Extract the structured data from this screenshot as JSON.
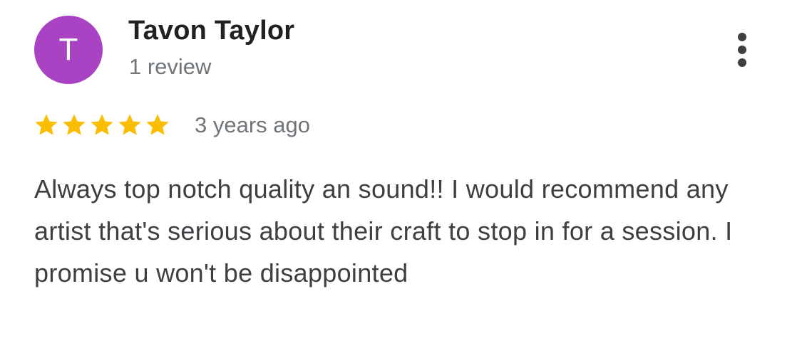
{
  "review": {
    "avatar_letter": "T",
    "avatar_color": "#a943c4",
    "author_name": "Tavon Taylor",
    "review_count": "1 review",
    "rating": 5,
    "rating_max": 5,
    "star_color": "#fbbc04",
    "time_ago": "3 years ago",
    "text": "Always top notch quality an sound!! I would recommend any artist that's serious about their craft to stop in for a session. I promise u won't be disappointed",
    "menu_icon": "more-vert-icon"
  }
}
